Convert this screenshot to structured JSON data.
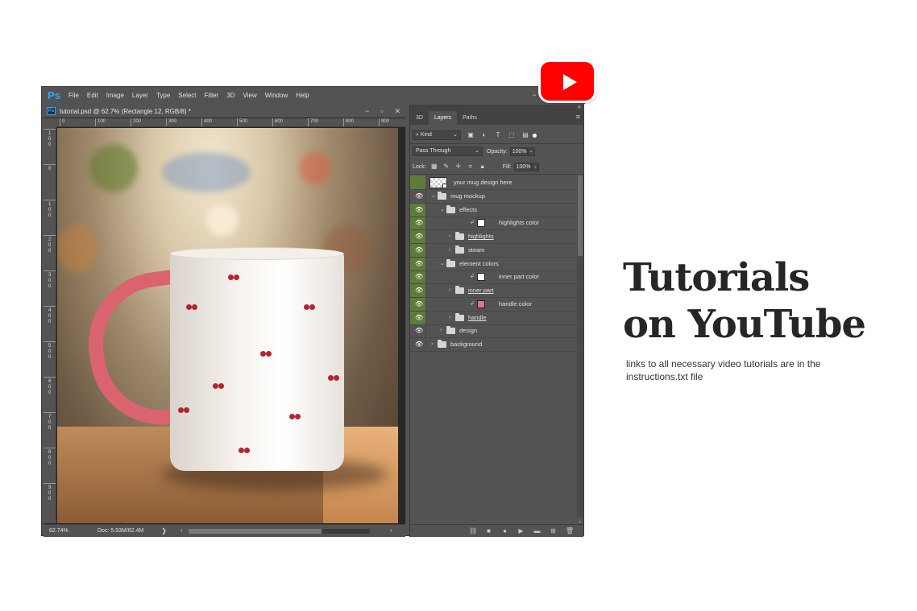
{
  "app": {
    "logo": "Ps",
    "menu": [
      "File",
      "Edit",
      "Image",
      "Layer",
      "Type",
      "Select",
      "Filter",
      "3D",
      "View",
      "Window",
      "Help"
    ],
    "minimize_glyph": "−"
  },
  "document": {
    "icon": "Ps",
    "title": "tutorial.psd @ 62.7% (Rectangle 12, RGB/8) *",
    "controls": [
      "−",
      "▫",
      "✕"
    ],
    "ruler_top": [
      "0",
      "100",
      "200",
      "300",
      "400",
      "500",
      "600",
      "700",
      "800",
      "900"
    ],
    "ruler_left": [
      "100",
      "0",
      "100",
      "200",
      "300",
      "400",
      "500",
      "600",
      "700",
      "800",
      "900"
    ],
    "status": {
      "zoom": "62.74%",
      "doc_info": "Doc: 5.93M/62.4M",
      "arrow": "❯",
      "scroll_left": "‹",
      "scroll_right": "›"
    }
  },
  "layers_panel": {
    "collapse_glyph": "»",
    "tabs": [
      "3D",
      "Layers",
      "Paths"
    ],
    "active_tab": "Layers",
    "menu_glyph": "≡",
    "kind": "Kind",
    "blend_mode": "Pass Through",
    "opacity_label": "Opacity:",
    "opacity": "100%",
    "lock_label": "Lock:",
    "fill_label": "Fill:",
    "fill": "100%",
    "layers": [
      {
        "name": "your mug design here",
        "indent": 0,
        "type": "smart",
        "eye": "green"
      },
      {
        "name": "mug mockup",
        "indent": 0,
        "type": "group-open",
        "eye": "plain"
      },
      {
        "name": "effects",
        "indent": 1,
        "type": "group-open",
        "eye": "green"
      },
      {
        "name": "highlights color",
        "indent": 2,
        "type": "fill",
        "swatch": "#ffffff",
        "eye": "green"
      },
      {
        "name": "highlights",
        "indent": 2,
        "type": "group-closed",
        "eye": "green",
        "underline": true
      },
      {
        "name": "steam",
        "indent": 2,
        "type": "group-closed",
        "eye": "green"
      },
      {
        "name": "element colors",
        "indent": 1,
        "type": "group-open",
        "eye": "green"
      },
      {
        "name": "inner part color",
        "indent": 2,
        "type": "fill",
        "swatch": "#ffffff",
        "eye": "green"
      },
      {
        "name": "inner part",
        "indent": 2,
        "type": "group-closed",
        "eye": "green",
        "underline": true
      },
      {
        "name": "handle color",
        "indent": 2,
        "type": "fill",
        "swatch": "#e8717e",
        "eye": "green"
      },
      {
        "name": "handle",
        "indent": 2,
        "type": "group-closed",
        "eye": "green",
        "underline": true
      },
      {
        "name": "design",
        "indent": 1,
        "type": "group-closed",
        "eye": "plain"
      },
      {
        "name": "background",
        "indent": 0,
        "type": "group-closed",
        "eye": "plain"
      }
    ]
  },
  "promo": {
    "headline_line1": "Tutorials",
    "headline_line2": "on YouTube",
    "subtext": "links to all necessary video tutorials are in the instructions.txt file"
  },
  "colors": {
    "youtube_red": "#ff0000",
    "ps_blue": "#31a8ff",
    "eye_green": "#5d7c3a",
    "handle_pink": "#d9646f"
  }
}
